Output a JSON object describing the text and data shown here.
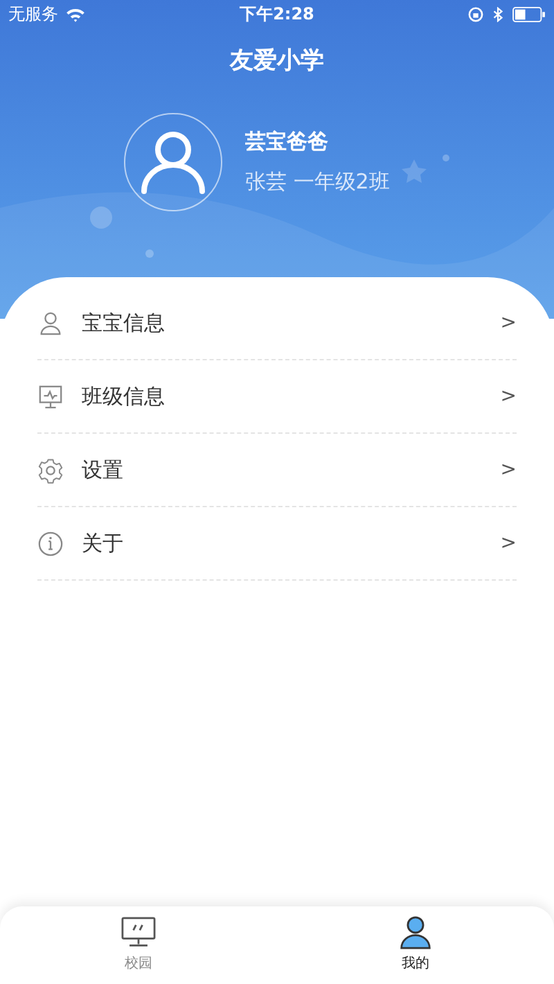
{
  "status_bar": {
    "carrier": "无服务",
    "time": "下午2:28"
  },
  "header": {
    "title": "友爱小学"
  },
  "profile": {
    "name": "芸宝爸爸",
    "detail": "张芸  一年级2班"
  },
  "menu": [
    {
      "kind": "person",
      "label": "宝宝信息",
      "chevron": ">"
    },
    {
      "kind": "board",
      "label": "班级信息",
      "chevron": ">"
    },
    {
      "kind": "gear",
      "label": "设置",
      "chevron": ">"
    },
    {
      "kind": "info",
      "label": "关于",
      "chevron": ">"
    }
  ],
  "tab_bar": [
    {
      "kind": "monitor",
      "label": "校园",
      "selected": false
    },
    {
      "kind": "user",
      "label": "我的",
      "selected": true
    }
  ]
}
